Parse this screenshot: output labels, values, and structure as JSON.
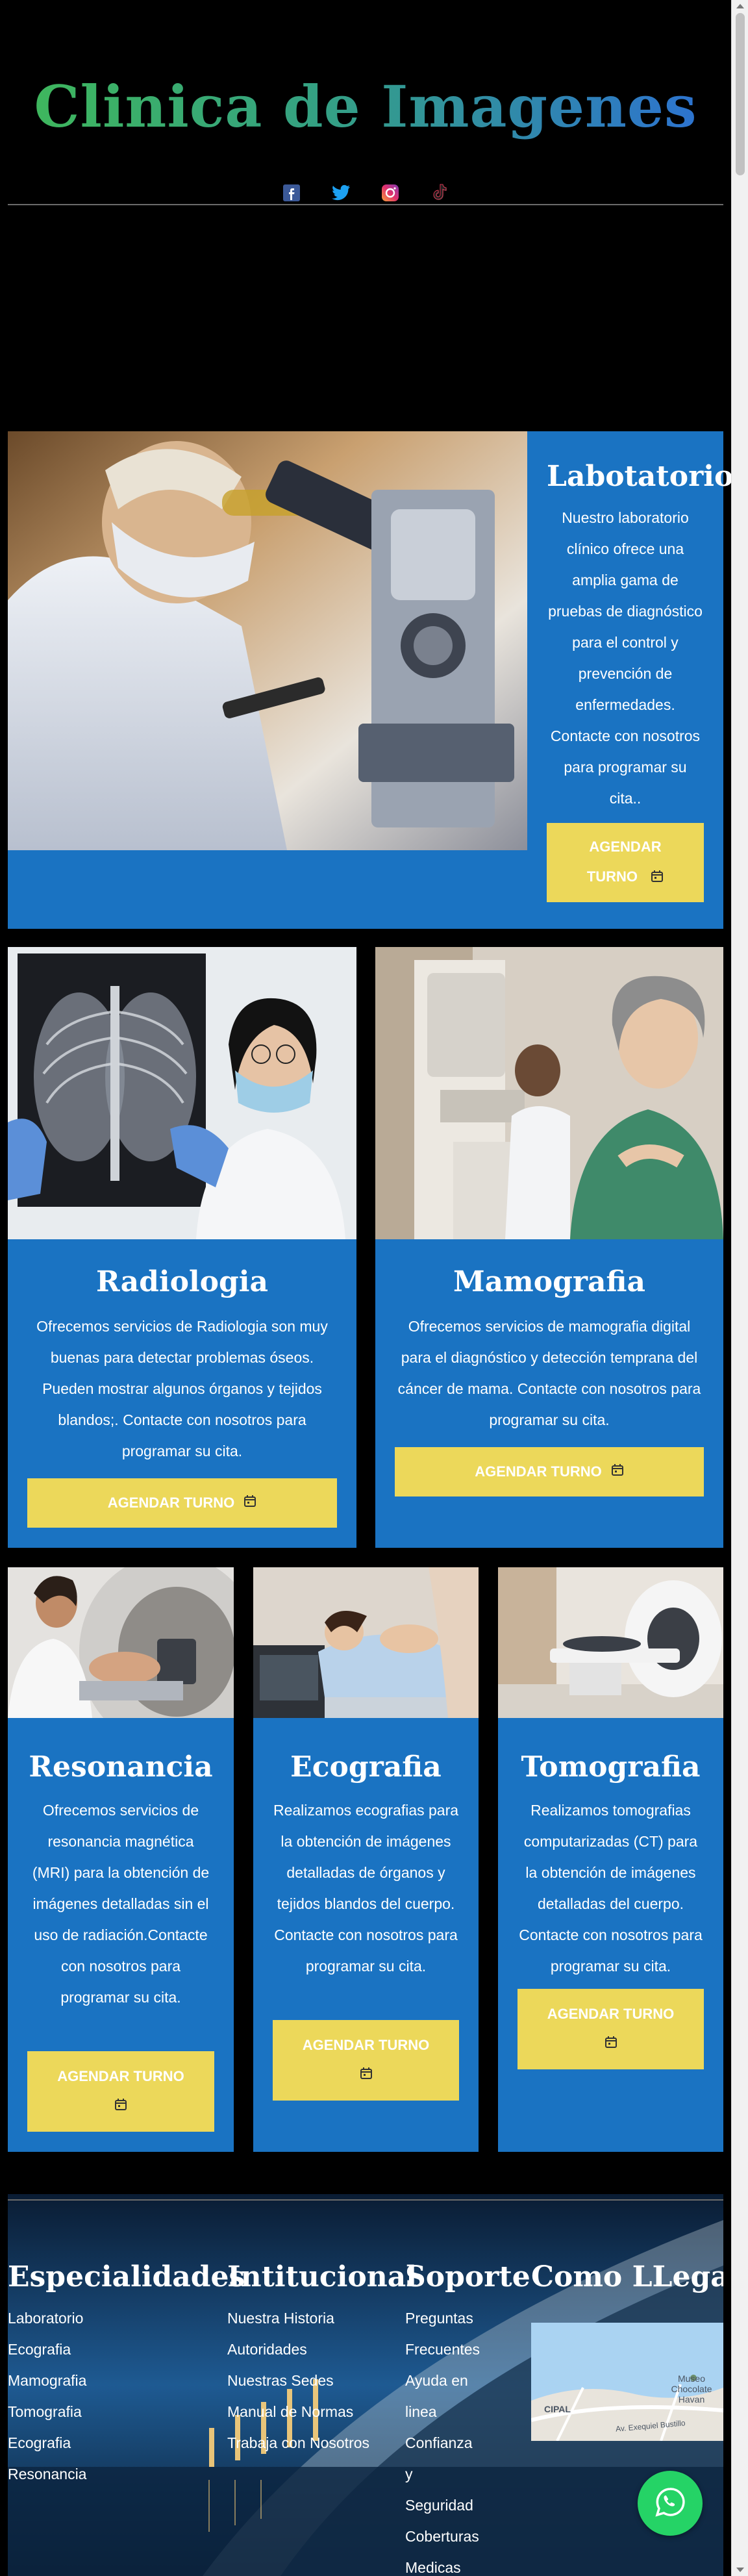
{
  "header": {
    "site_title": "Clinica de Imagenes",
    "socials": [
      "facebook-icon",
      "twitter-icon",
      "instagram-icon",
      "tiktok-icon"
    ]
  },
  "lab": {
    "title": "Labotatorio",
    "text": "Nuestro laboratorio clínico ofrece una amplia gama de pruebas de diagnóstico para el control y prevención de enfermedades. Contacte con nosotros para programar su cita..",
    "button": "AGENDAR TURNO"
  },
  "radiologia": {
    "title": "Radiologia",
    "text": "Ofrecemos servicios de Radiologia son muy buenas para detectar problemas óseos. Pueden mostrar algunos órganos y tejidos blandos;. Contacte con nosotros para programar su cita.",
    "button": "AGENDAR TURNO"
  },
  "mamografia": {
    "title": "Mamografia",
    "text": "Ofrecemos servicios de mamografia digital para el diagnóstico y detección temprana del cáncer de mama. Contacte con nosotros para programar su cita.",
    "button": "AGENDAR TURNO"
  },
  "resonancia": {
    "title": "Resonancia",
    "text": "Ofrecemos servicios de resonancia magnética (MRI) para la obtención de imágenes detalladas sin el uso de radiación.Contacte con nosotros para programar su cita.",
    "button": "AGENDAR TURNO"
  },
  "ecografia": {
    "title": "Ecografia",
    "text": "Realizamos ecografias para la obtención de imágenes detalladas de órganos y tejidos blandos del cuerpo. Contacte con nosotros para programar su cita.",
    "button": "AGENDAR TURNO"
  },
  "tomografia": {
    "title": "Tomografia",
    "text": "Realizamos tomografias computarizadas (CT) para la obtención de imágenes detalladas del cuerpo. Contacte con nosotros para programar su cita.",
    "button": "AGENDAR TURNO"
  },
  "footer": {
    "especialidades": {
      "title": "Especialidades",
      "links": [
        "Laboratorio",
        "Ecografia",
        "Mamografia",
        "Tomografia",
        "Ecografia",
        "Resonancia"
      ]
    },
    "institucional": {
      "title": "Intitucional",
      "links": [
        "Nuestra Historia",
        "Autoridades",
        "Nuestras Sedes",
        "Manual de Normas",
        "Trabaja con Nosotros"
      ]
    },
    "soporte": {
      "title": "Soporte",
      "links": [
        "Preguntas Frecuentes",
        "Ayuda en linea",
        "Confianza y Seguridad",
        "Coberturas Medicas"
      ]
    },
    "como_llegar": {
      "title": "Como LLegar",
      "map_labels": [
        "Museo Chocolate Havan",
        "Av. Exequiel Bustillo",
        "CIPAL"
      ]
    }
  },
  "colors": {
    "card_blue": "#1a73c2",
    "button_yellow": "#ecd85a",
    "whatsapp_green": "#25d366"
  }
}
